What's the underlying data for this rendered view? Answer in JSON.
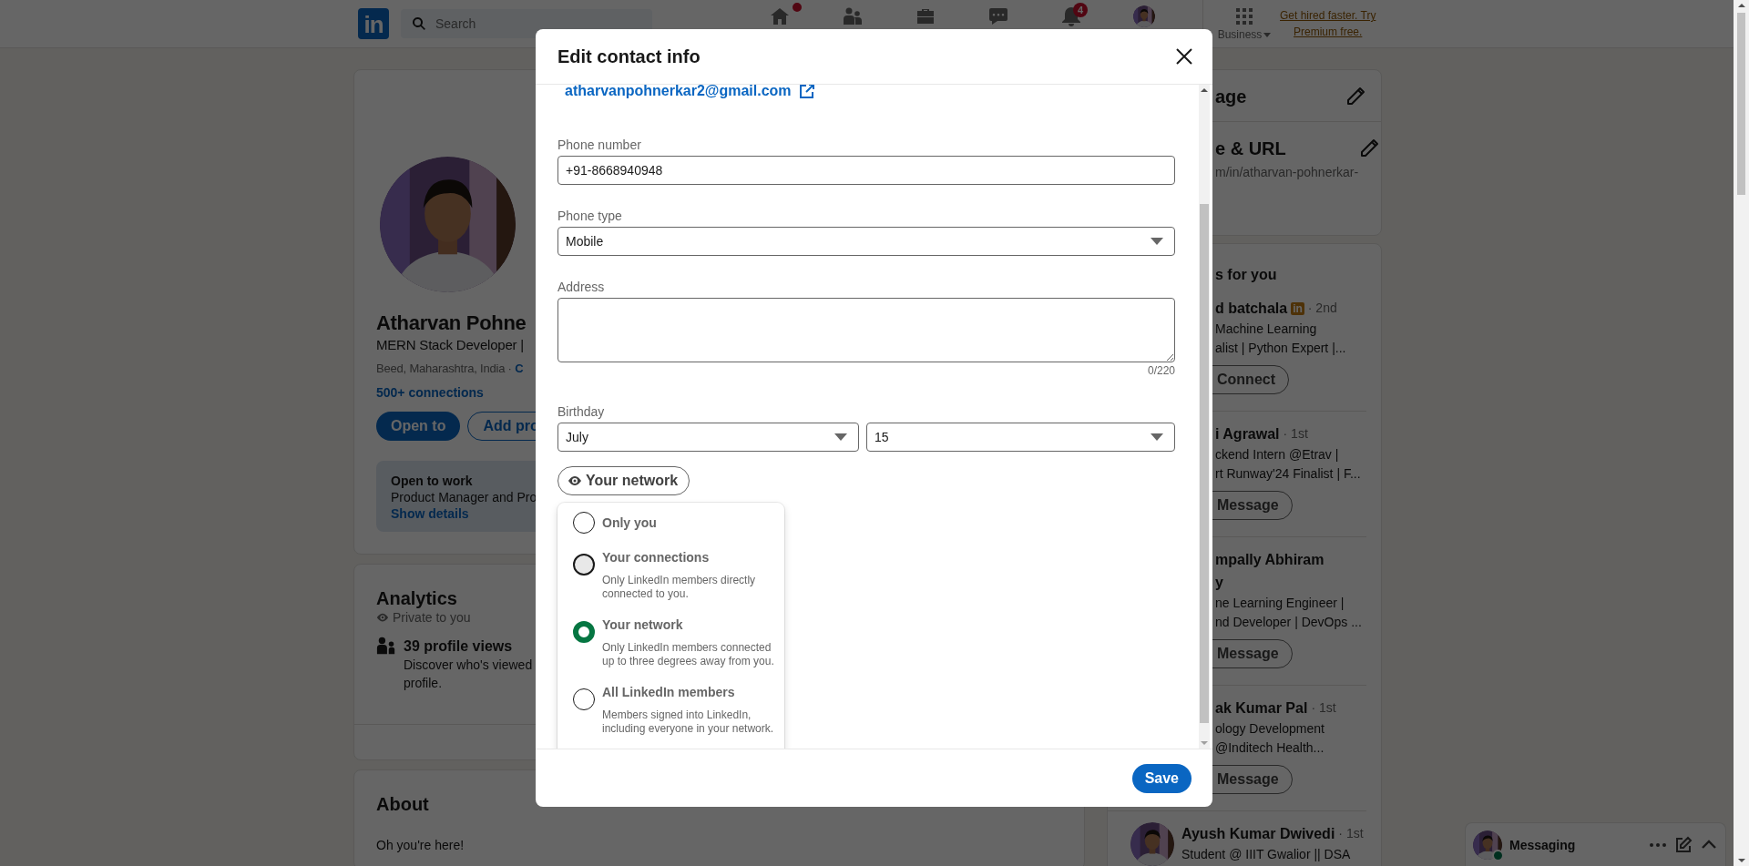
{
  "nav": {
    "logo": "in",
    "search_placeholder": "Search",
    "items": [
      {
        "kind": "home",
        "dot": true
      },
      {
        "kind": "people",
        "dot": false
      },
      {
        "kind": "jobs",
        "dot": false
      },
      {
        "kind": "messaging",
        "dot": false
      },
      {
        "kind": "notifications",
        "dot": false,
        "badge": "4"
      },
      {
        "kind": "avatar",
        "dot": false
      }
    ],
    "business": "Business",
    "premium_lines": [
      "Get hired faster. Try",
      "Premium free."
    ]
  },
  "profile": {
    "name": "Atharvan Pohne",
    "headline": "MERN Stack Developer |",
    "location": "Beed, Maharashtra, India ·",
    "contact_link": "C",
    "connections": "500+ connections",
    "buttons": [
      {
        "label": "Open to",
        "primary": true
      },
      {
        "label": "Add pro",
        "primary": false
      }
    ],
    "open_to_work": {
      "title": "Open to work",
      "text": "Product Manager and Pro",
      "link": "Show details"
    }
  },
  "analytics": {
    "title": "Analytics",
    "privacy": "Private to you",
    "items": [
      {
        "title": "39 profile views",
        "description_lines": [
          "Discover who's viewed",
          "profile."
        ]
      }
    ]
  },
  "about": {
    "title": "About",
    "text": "Oh you're here!"
  },
  "settings": [
    {
      "title": "age"
    },
    {
      "title": "e & URL",
      "subtitle": "m/in/atharvan-pohnerkar-"
    }
  ],
  "suggestions": {
    "title": "s for you",
    "people": [
      {
        "name_lines": [
          "d batchala"
        ],
        "premium_badge": "in",
        "degree": "· 2nd",
        "headline_lines": [
          "Machine Learning",
          "alist | Python Expert |..."
        ],
        "action": "Connect"
      },
      {
        "name_lines": [
          "i Agrawal"
        ],
        "degree": "· 1st",
        "headline_lines": [
          "ckend Intern @Etrav |",
          "rt Runway'24 Finalist | F..."
        ],
        "action": "Message"
      },
      {
        "name_lines": [
          "mpally Abhiram",
          "y"
        ],
        "headline_lines": [
          "ne Learning Engineer |",
          "nd Developer | DevOps ..."
        ],
        "action": "Message"
      },
      {
        "name_lines": [
          "ak Kumar Pal"
        ],
        "degree": "· 1st",
        "headline_lines": [
          "ology Development",
          "@Inditech Health..."
        ],
        "action": "Message"
      },
      {
        "name_lines": [
          "Ayush Kumar Dwivedi"
        ],
        "degree": "· 1st",
        "headline_lines": [
          "Student @ IIIT Gwalior || DSA"
        ],
        "avatar": true
      }
    ]
  },
  "messaging": {
    "title": "Messaging",
    "online": true
  },
  "modal": {
    "title": "Edit contact info",
    "email": "atharvanpohnerkar2@gmail.com",
    "fields": [
      {
        "kind": "text",
        "label": "Phone number",
        "value": "+91-8668940948"
      },
      {
        "kind": "select",
        "label": "Phone type",
        "value": "Mobile"
      },
      {
        "kind": "textarea",
        "label": "Address",
        "counter": "0/220"
      },
      {
        "kind": "select_pair",
        "label": "Birthday",
        "values": [
          "July",
          "15"
        ]
      }
    ],
    "visibility": {
      "label": "Your network",
      "expanded": true,
      "options": [
        {
          "label": "Only you",
          "selected": false,
          "hovered": false
        },
        {
          "label": "Your connections",
          "description_lines": [
            "Only LinkedIn members directly",
            "connected to you."
          ],
          "selected": false,
          "hovered": true
        },
        {
          "label": "Your network",
          "description_lines": [
            "Only LinkedIn members connected",
            "up to three degrees away from you."
          ],
          "selected": true,
          "hovered": false
        },
        {
          "label": "All LinkedIn members",
          "description_lines": [
            "Members signed into LinkedIn,",
            "including everyone in your network."
          ],
          "selected": false,
          "hovered": false
        }
      ]
    },
    "save": "Save"
  }
}
